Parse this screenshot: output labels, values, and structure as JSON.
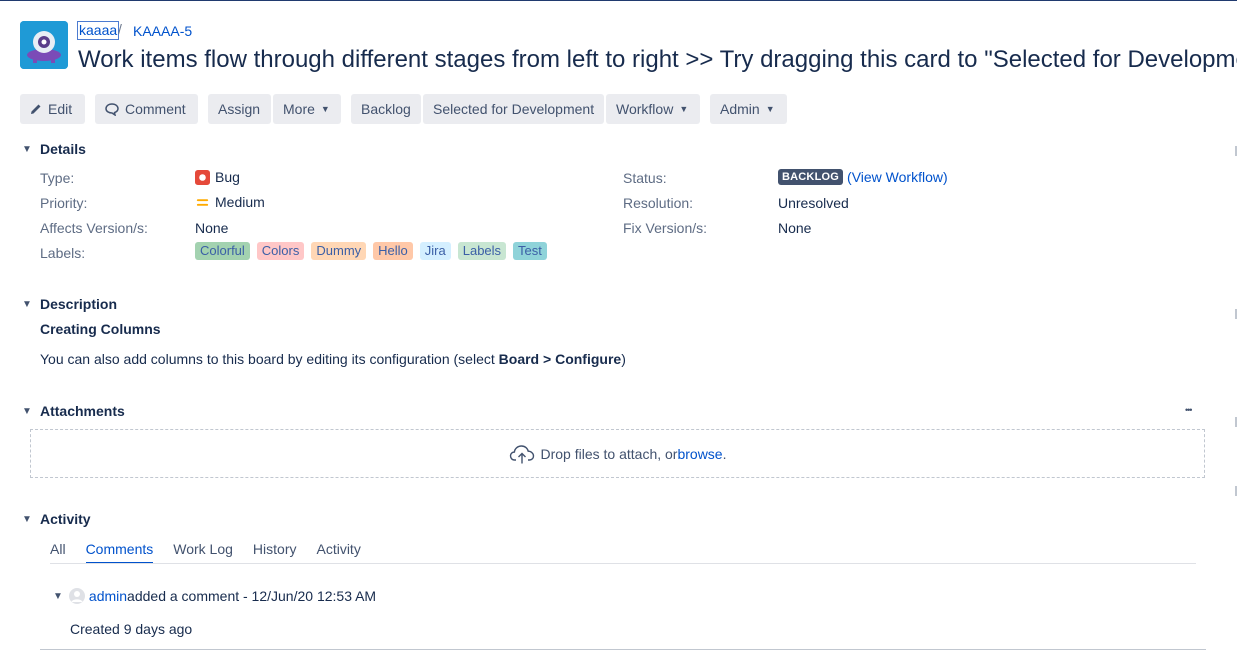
{
  "header": {
    "project_name": "kaaaa",
    "separator": "/",
    "issue_key": "KAAAA-5",
    "summary": "Work items flow through different stages from left to right >> Try dragging this card to \"Selected for Development\""
  },
  "toolbar": {
    "edit": "Edit",
    "comment": "Comment",
    "assign": "Assign",
    "more": "More",
    "backlog": "Backlog",
    "selected_for_development": "Selected for Development",
    "workflow": "Workflow",
    "admin": "Admin"
  },
  "details": {
    "title": "Details",
    "type_label": "Type:",
    "type_value": "Bug",
    "priority_label": "Priority:",
    "priority_value": "Medium",
    "affects_label": "Affects Version/s:",
    "affects_value": "None",
    "labels_label": "Labels:",
    "labels": [
      {
        "text": "Colorful",
        "bg": "#a3d2b0"
      },
      {
        "text": "Colors",
        "bg": "#ffc7c7"
      },
      {
        "text": "Dummy",
        "bg": "#ffd7b5"
      },
      {
        "text": "Hello",
        "bg": "#ffc8a8"
      },
      {
        "text": "Jira",
        "bg": "#d4efff"
      },
      {
        "text": "Labels",
        "bg": "#c8e6d2"
      },
      {
        "text": "Test",
        "bg": "#8fd3d9"
      }
    ],
    "status_label": "Status:",
    "status_value": "BACKLOG",
    "view_workflow": "View Workflow",
    "resolution_label": "Resolution:",
    "resolution_value": "Unresolved",
    "fix_label": "Fix Version/s:",
    "fix_value": "None"
  },
  "description": {
    "title": "Description",
    "heading": "Creating Columns",
    "text_before": "You can also add columns to this board by editing its configuration (select ",
    "bold1": "Board",
    "arrow": " > ",
    "bold2": "Configure",
    "text_after": ")"
  },
  "attachments": {
    "title": "Attachments",
    "more": "•••",
    "drop_text": "Drop files to attach, or ",
    "browse": "browse",
    "period": "."
  },
  "activity": {
    "title": "Activity",
    "tabs": [
      "All",
      "Comments",
      "Work Log",
      "History",
      "Activity"
    ],
    "active_tab": "Comments",
    "comment_author": "admin",
    "comment_action": " added a comment - 12/Jun/20 12:53 AM",
    "comment_body": "Created 9 days ago"
  },
  "colors": {
    "accent": "#0052cc",
    "bug": "#e5493a",
    "priority_medium": "#ffab00",
    "status_backlog": "#42526e"
  }
}
